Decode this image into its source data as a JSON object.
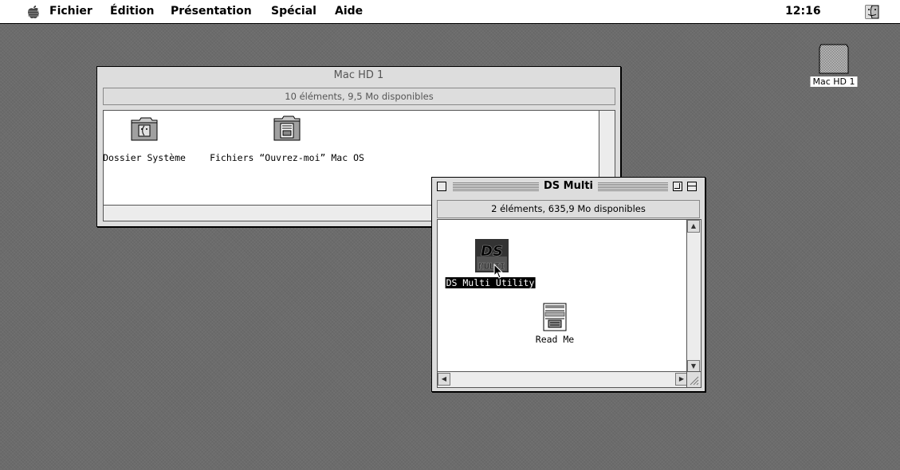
{
  "menubar": {
    "items": [
      "Fichier",
      "Édition",
      "Présentation",
      "Spécial",
      "Aide"
    ],
    "clock": "12:16"
  },
  "desktop": {
    "disk_label": "Mac HD 1"
  },
  "window_hd": {
    "title": "Mac HD 1",
    "info": "10 éléments, 9,5 Mo disponibles",
    "items": [
      {
        "label": "Dossier Système"
      },
      {
        "label": "Fichiers “Ouvrez-moi” Mac OS"
      }
    ]
  },
  "window_ds": {
    "title": "DS Multi",
    "info": "2 éléments, 635,9 Mo disponibles",
    "items": [
      {
        "label": "DS Multi Utility",
        "selected": true
      },
      {
        "label": "Read Me"
      }
    ]
  },
  "colors": {
    "desktop": "#6c6c6c",
    "window_frame": "#dddddd",
    "selection": "#000000"
  }
}
